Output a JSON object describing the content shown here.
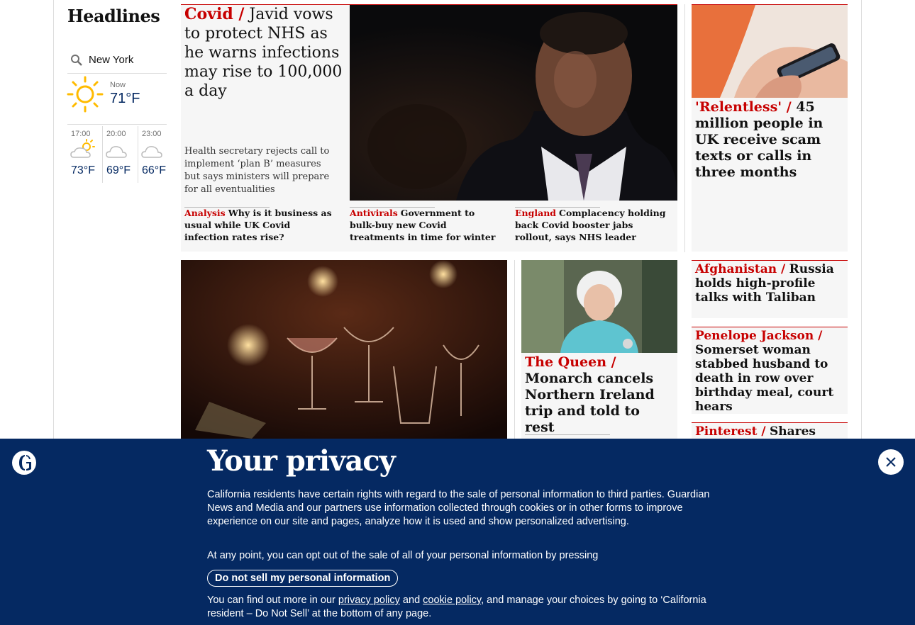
{
  "left": {
    "title": "Headlines",
    "weather": {
      "location": "New York",
      "now_label": "Now",
      "now_temp": "71°F",
      "forecast": [
        {
          "time": "17:00",
          "temp": "73°F",
          "icon": "partly-cloudy-sun-icon"
        },
        {
          "time": "20:00",
          "temp": "69°F",
          "icon": "cloudy-moon-icon"
        },
        {
          "time": "23:00",
          "temp": "66°F",
          "icon": "cloudy-moon-icon"
        }
      ]
    }
  },
  "lead": {
    "kicker": "Covid /",
    "headline": "Javid vows to protect NHS as he warns infections may rise to 100,000 a day",
    "standfirst": "Health secretary rejects call to implement ‘plan B’ measures but says ministers will prepare for all eventualities",
    "sublinks": [
      {
        "kicker": "Analysis",
        "text": "Why is it business as usual while UK Covid infection rates rise?"
      },
      {
        "kicker": "Antivirals",
        "text": "Government to bulk-buy new Covid treatments in time for winter"
      },
      {
        "kicker": "England",
        "text": "Complacency holding back Covid booster jabs rollout, says NHS leader"
      }
    ]
  },
  "right": {
    "scam": {
      "kicker": "'Relentless' /",
      "headline": "45 million people in UK receive scam texts or calls in three months"
    },
    "afghanistan": {
      "kicker": "Afghanistan /",
      "headline": "Russia holds high-profile talks with Taliban"
    },
    "jackson": {
      "kicker": "Penelope Jackson /",
      "headline": "Somerset woman stabbed husband to death in row over birthday meal, court hears"
    },
    "pinterest": {
      "kicker": "Pinterest /",
      "headline": "Shares soar"
    }
  },
  "queen": {
    "kicker": "The Queen /",
    "headline": "Monarch cancels Northern Ireland trip and told to rest"
  },
  "privacy": {
    "title": "Your privacy",
    "p1": "California residents have certain rights with regard to the sale of personal information to third parties. Guardian News and Media and our partners use information collected through cookies or in other forms to improve experience on our site and pages, analyze how it is used and show personalized advertising.",
    "p2": "At any point, you can opt out of the sale of all of your personal information by pressing",
    "button": "Do not sell my personal information",
    "p3_a": "You can find out more in our ",
    "privacy_link": "privacy policy",
    "p3_b": " and ",
    "cookie_link": "cookie policy",
    "p3_c": ", and manage your choices by going to ‘California resident – Do Not Sell’ at the bottom of any page."
  },
  "colors": {
    "brand_blue": "#052962",
    "news_red": "#c70000",
    "panel_grey": "#f6f6f6"
  }
}
